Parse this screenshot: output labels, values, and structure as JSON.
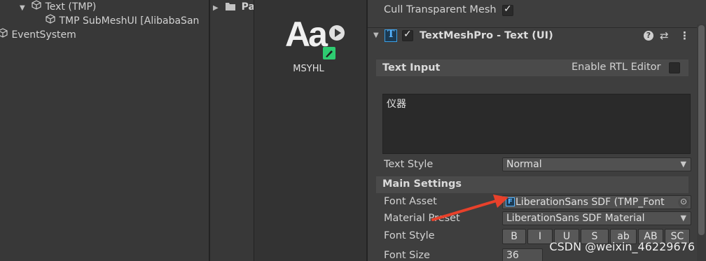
{
  "hierarchy": {
    "items": [
      {
        "label": "Text (TMP)",
        "icon": "gameobject-cube-icon",
        "expand": "▼"
      },
      {
        "label": "TMP SubMeshUI [AlibabaSan",
        "icon": "gameobject-cube-icon"
      },
      {
        "label": "EventSystem",
        "icon": "gameobject-cube-icon"
      }
    ]
  },
  "project": {
    "folder_label": "Pa",
    "asset": {
      "thumb_text": "Aa",
      "name": "MSYHL",
      "icon": "tmp-font-asset-icon"
    }
  },
  "inspector": {
    "cull_transparent_label": "Cull Transparent Mesh",
    "component": {
      "title": "TextMeshPro - Text (UI)",
      "icons": [
        "help-icon",
        "presets-icon",
        "more-icon"
      ]
    },
    "text_input": {
      "section_title": "Text Input",
      "rtl_label": "Enable RTL Editor",
      "text_value": "仪器"
    },
    "text_style": {
      "label": "Text Style",
      "value": "Normal"
    },
    "main_settings": {
      "section_title": "Main Settings",
      "font_asset": {
        "label": "Font Asset",
        "value": "LiberationSans SDF (TMP_Font"
      },
      "material_preset": {
        "label": "Material Preset",
        "value": "LiberationSans SDF Material"
      },
      "font_style": {
        "label": "Font Style",
        "buttons": [
          "B",
          "I",
          "U",
          "S",
          "ab",
          "AB",
          "SC"
        ]
      },
      "font_size": {
        "label": "Font Size",
        "value": "36"
      }
    }
  },
  "watermark": "CSDN @weixin_46229676",
  "colors": {
    "accent_arrow": "#e8412b",
    "asset_badge": "#2ecc71",
    "selection": "#2c5d87"
  }
}
